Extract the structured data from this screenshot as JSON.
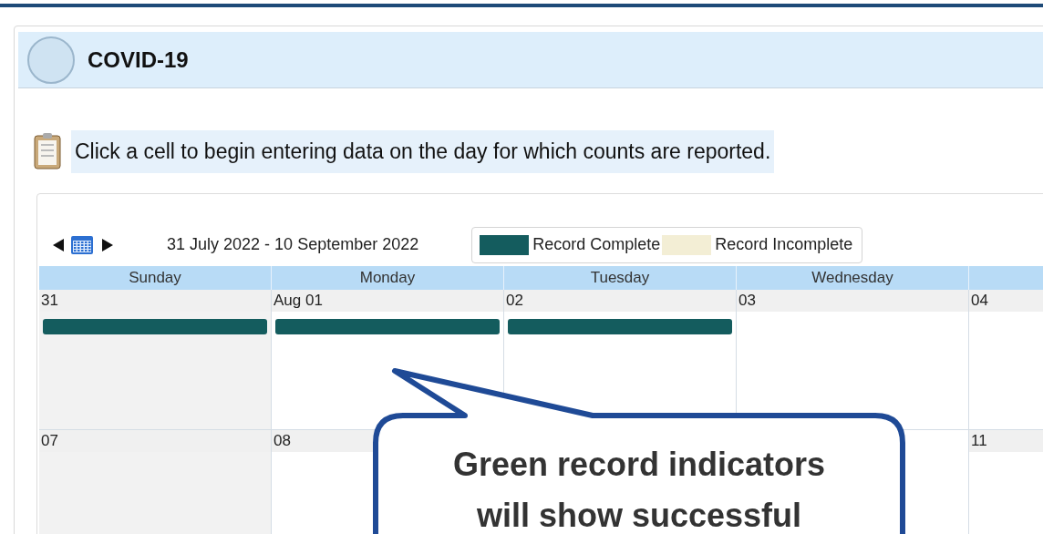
{
  "header": {
    "title": "COVID-19"
  },
  "instruction": "Click a cell to begin entering data on the day for which counts are reported.",
  "calendar": {
    "range_start": "31 July 2022",
    "range_separator": "-",
    "range_end": "10 September 2022",
    "legend": [
      {
        "label": "Record Complete",
        "color": "#145c5e"
      },
      {
        "label": "Record Incomplete",
        "color": "#f3eed5"
      }
    ],
    "columns": [
      {
        "label": "Sunday",
        "shaded": true
      },
      {
        "label": "Monday",
        "shaded": false
      },
      {
        "label": "Tuesday",
        "shaded": false
      },
      {
        "label": "Wednesday",
        "shaded": false
      },
      {
        "shaded": false
      }
    ],
    "weeks": [
      {
        "left": [
          {
            "day": "31",
            "recorded": true
          },
          {
            "day": "Aug 01",
            "recorded": true
          },
          {
            "day": "02",
            "recorded": true
          },
          {
            "day": "03",
            "recorded": false
          },
          {
            "day": "04",
            "recorded": false
          }
        ]
      },
      {
        "left": [
          {
            "day": "07",
            "recorded": false
          },
          {
            "day": "08",
            "recorded": false
          }
        ],
        "right": [
          {
            "day": "11",
            "recorded": false
          }
        ]
      }
    ]
  },
  "callout": {
    "lines": [
      "Green record indicators",
      "will show successful"
    ]
  }
}
